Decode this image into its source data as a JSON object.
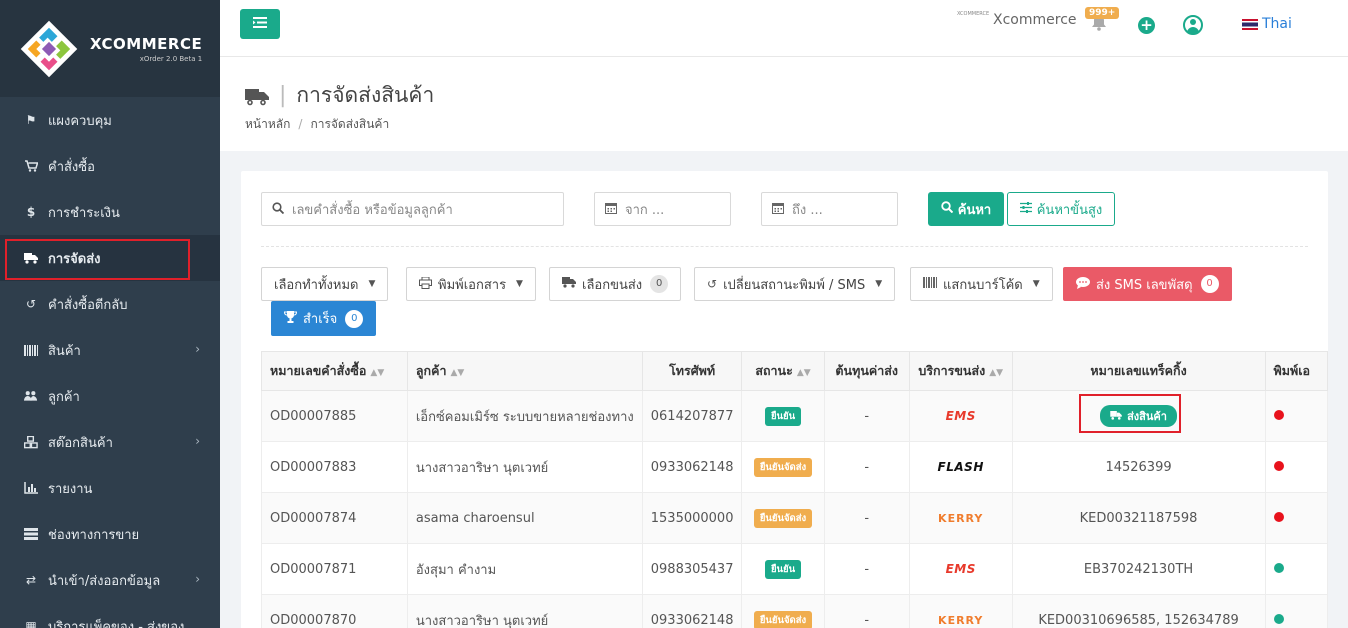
{
  "sidebar": {
    "logo_title": "XCOMMERCE",
    "logo_sub": "xOrder 2.0 Beta 1",
    "items": [
      {
        "label": "แผงควบคุม",
        "icon": "flag-icon"
      },
      {
        "label": "คำสั่งซื้อ",
        "icon": "cart-icon"
      },
      {
        "label": "การชำระเงิน",
        "icon": "dollar-icon"
      },
      {
        "label": "การจัดส่ง",
        "icon": "truck-icon"
      },
      {
        "label": "คำสั่งซื้อตีกลับ",
        "icon": "undo-icon"
      },
      {
        "label": "สินค้า",
        "icon": "barcode-icon"
      },
      {
        "label": "ลูกค้า",
        "icon": "users-icon"
      },
      {
        "label": "สต๊อกสินค้า",
        "icon": "cubes-icon"
      },
      {
        "label": "รายงาน",
        "icon": "bar-chart-icon"
      },
      {
        "label": "ช่องทางการขาย",
        "icon": "channels-icon"
      },
      {
        "label": "นำเข้า/ส่งออกข้อมูล",
        "icon": "exchange-icon"
      },
      {
        "label": "บริการแพ็คของ - ส่งของ",
        "icon": "package-icon"
      }
    ]
  },
  "topbar": {
    "brand_mini": "XCOMMERCE",
    "brand": "Xcommerce",
    "notif_badge": "999+",
    "language": "Thai"
  },
  "page": {
    "title": "การจัดส่งสินค้า",
    "breadcrumb_home": "หน้าหลัก",
    "breadcrumb_current": "การจัดส่งสินค้า"
  },
  "filters": {
    "search_placeholder": "เลขคำสั่งซื้อ หรือข้อมูลลูกค้า",
    "date_from": "จาก ...",
    "date_to": "ถึง ...",
    "search_btn": "ค้นหา",
    "advanced_btn": "ค้นหาขั้นสูง"
  },
  "toolbar": {
    "select_all": "เลือกทำทั้งหมด",
    "print_docs": "พิมพ์เอกสาร",
    "select_carrier": "เลือกขนส่ง",
    "select_carrier_count": "0",
    "change_status": "เปลี่ยนสถานะพิมพ์ / SMS",
    "scan_barcode": "แสกนบาร์โค้ด",
    "send_sms": "ส่ง SMS เลขพัสดุ",
    "send_sms_count": "0",
    "success": "สำเร็จ",
    "success_count": "0"
  },
  "table": {
    "headers": [
      "หมายเลขคำสั่งซื้อ",
      "ลูกค้า",
      "โทรศัพท์",
      "สถานะ",
      "ต้นทุนค่าส่ง",
      "บริการขนส่ง",
      "หมายเลขแทร็คกิ้ง",
      "พิมพ์เอ"
    ],
    "ship_label": "ส่งสินค้า",
    "rows": [
      {
        "order": "OD00007885",
        "customer": "เอ็กซ์คอมเมิร์ซ ระบบขายหลายช่องทาง",
        "phone": "0614207877",
        "status": "ยืนยัน",
        "cost": "-",
        "carrier": "EMS",
        "tracking": ""
      },
      {
        "order": "OD00007883",
        "customer": "นางสาวอาริษา นุตเวทย์",
        "phone": "0933062148",
        "status": "ยืนยันจัดส่ง",
        "cost": "-",
        "carrier": "FLASH",
        "tracking": "14526399"
      },
      {
        "order": "OD00007874",
        "customer": "asama charoensul",
        "phone": "1535000000",
        "status": "ยืนยันจัดส่ง",
        "cost": "-",
        "carrier": "KERRY",
        "tracking": "KED00321187598"
      },
      {
        "order": "OD00007871",
        "customer": "อังสุมา คำงาม",
        "phone": "0988305437",
        "status": "ยืนยัน",
        "cost": "-",
        "carrier": "EMS",
        "tracking": "EB370242130TH"
      },
      {
        "order": "OD00007870",
        "customer": "นางสาวอาริษา นุตเวทย์",
        "phone": "0933062148",
        "status": "ยืนยันจัดส่ง",
        "cost": "-",
        "carrier": "KERRY",
        "tracking": "KED00310696585, 152634789"
      }
    ]
  }
}
